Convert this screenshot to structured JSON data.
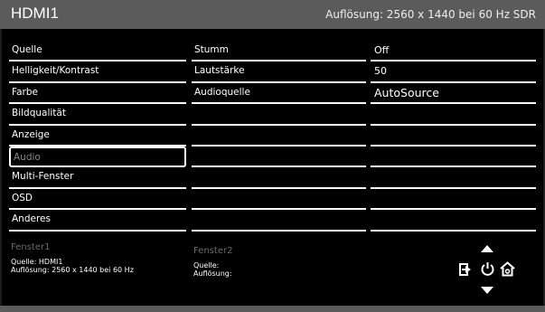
{
  "header": {
    "title": "HDMI1",
    "resolution": "Auflösung: 2560 x 1440 bei 60 Hz SDR"
  },
  "menu": {
    "items": [
      {
        "label": "Quelle"
      },
      {
        "label": "Helligkeit/Kontrast"
      },
      {
        "label": "Farbe"
      },
      {
        "label": "Bildqualität"
      },
      {
        "label": "Anzeige"
      },
      {
        "label": "Audio",
        "selected": true
      },
      {
        "label": "Multi-Fenster"
      },
      {
        "label": "OSD"
      },
      {
        "label": "Anderes"
      }
    ]
  },
  "submenu": {
    "items": [
      {
        "label": "Stumm"
      },
      {
        "label": "Lautstärke"
      },
      {
        "label": "Audioquelle"
      }
    ]
  },
  "values": {
    "items": [
      {
        "label": "Off"
      },
      {
        "label": "50"
      },
      {
        "label": "AutoSource"
      }
    ]
  },
  "window1": {
    "heading": "Fenster1",
    "source": "Quelle: HDMI1",
    "resolution": "Auflösung: 2560 x 1440 bei 60 Hz"
  },
  "window2": {
    "heading": "Fenster2",
    "source": "Quelle:",
    "resolution": "Auflösung:"
  },
  "keys": {
    "icons": [
      "up-arrow-icon",
      "input-icon",
      "power-icon",
      "home-icon",
      "down-arrow-icon"
    ]
  }
}
